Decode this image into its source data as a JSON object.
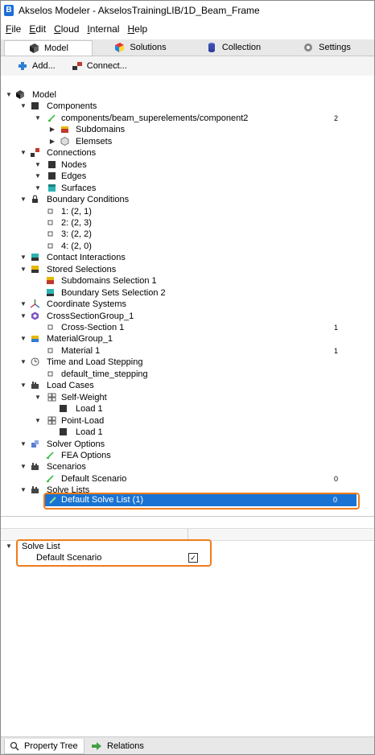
{
  "window": {
    "title": "Akselos Modeler - AkselosTrainingLIB/1D_Beam_Frame"
  },
  "menu": [
    {
      "label": "File",
      "accel": "F",
      "rest": "ile"
    },
    {
      "label": "Edit",
      "accel": "E",
      "rest": "dit"
    },
    {
      "label": "Cloud",
      "accel": "C",
      "rest": "loud"
    },
    {
      "label": "Internal",
      "accel": "I",
      "rest": "nternal"
    },
    {
      "label": "Help",
      "accel": "H",
      "rest": "elp"
    }
  ],
  "tabs": {
    "model": "Model",
    "solutions": "Solutions",
    "collection": "Collection",
    "settings": "Settings"
  },
  "toolbar": {
    "add": "Add...",
    "connect": "Connect..."
  },
  "tree": [
    {
      "label": "Model",
      "depth": 0,
      "expander": "open",
      "icon": "model-icon",
      "count": ""
    },
    {
      "label": "Components",
      "depth": 1,
      "expander": "open",
      "icon": "components-icon",
      "count": ""
    },
    {
      "label": "components/beam_superelements/component2",
      "depth": 2,
      "expander": "open",
      "icon": "component-file-icon",
      "count": "2"
    },
    {
      "label": "Subdomains",
      "depth": 3,
      "expander": "closed",
      "icon": "subdomains-icon",
      "count": ""
    },
    {
      "label": "Elemsets",
      "depth": 3,
      "expander": "closed",
      "icon": "elemsets-icon",
      "count": ""
    },
    {
      "label": "Connections",
      "depth": 1,
      "expander": "open",
      "icon": "connections-icon",
      "count": ""
    },
    {
      "label": "Nodes",
      "depth": 2,
      "expander": "open",
      "icon": "nodes-icon",
      "count": ""
    },
    {
      "label": "Edges",
      "depth": 2,
      "expander": "open",
      "icon": "edges-icon",
      "count": ""
    },
    {
      "label": "Surfaces",
      "depth": 2,
      "expander": "open",
      "icon": "surfaces-icon",
      "count": ""
    },
    {
      "label": "Boundary Conditions",
      "depth": 1,
      "expander": "open",
      "icon": "lock-icon",
      "count": ""
    },
    {
      "label": "1: (2, 1)",
      "depth": 2,
      "expander": "none",
      "icon": "bullet-icon",
      "count": ""
    },
    {
      "label": "2: (2, 3)",
      "depth": 2,
      "expander": "none",
      "icon": "bullet-icon",
      "count": ""
    },
    {
      "label": "3: (2, 2)",
      "depth": 2,
      "expander": "none",
      "icon": "bullet-icon",
      "count": ""
    },
    {
      "label": "4: (2, 0)",
      "depth": 2,
      "expander": "none",
      "icon": "bullet-icon",
      "count": ""
    },
    {
      "label": "Contact Interactions",
      "depth": 1,
      "expander": "open",
      "icon": "contact-icon",
      "count": ""
    },
    {
      "label": "Stored Selections",
      "depth": 1,
      "expander": "open",
      "icon": "stored-selections-icon",
      "count": ""
    },
    {
      "label": "Subdomains Selection 1",
      "depth": 2,
      "expander": "none",
      "icon": "subdomains-selection-icon",
      "count": ""
    },
    {
      "label": "Boundary Sets Selection 2",
      "depth": 2,
      "expander": "none",
      "icon": "boundary-selection-icon",
      "count": ""
    },
    {
      "label": "Coordinate Systems",
      "depth": 1,
      "expander": "open",
      "icon": "axes-icon",
      "count": ""
    },
    {
      "label": "CrossSectionGroup_1",
      "depth": 1,
      "expander": "open",
      "icon": "cross-section-group-icon",
      "count": ""
    },
    {
      "label": "Cross-Section 1",
      "depth": 2,
      "expander": "none",
      "icon": "bullet-icon",
      "count": "1"
    },
    {
      "label": "MaterialGroup_1",
      "depth": 1,
      "expander": "open",
      "icon": "material-group-icon",
      "count": ""
    },
    {
      "label": "Material 1",
      "depth": 2,
      "expander": "none",
      "icon": "bullet-icon",
      "count": "1"
    },
    {
      "label": "Time and Load Stepping",
      "depth": 1,
      "expander": "open",
      "icon": "clock-icon",
      "count": ""
    },
    {
      "label": "default_time_stepping",
      "depth": 2,
      "expander": "none",
      "icon": "bullet-icon",
      "count": ""
    },
    {
      "label": "Load Cases",
      "depth": 1,
      "expander": "open",
      "icon": "load-cases-icon",
      "count": ""
    },
    {
      "label": "Self-Weight",
      "depth": 2,
      "expander": "open",
      "icon": "grid-icon",
      "count": ""
    },
    {
      "label": "Load 1",
      "depth": 3,
      "expander": "none",
      "icon": "load-icon",
      "count": ""
    },
    {
      "label": "Point-Load",
      "depth": 2,
      "expander": "open",
      "icon": "grid-icon",
      "count": ""
    },
    {
      "label": "Load 1",
      "depth": 3,
      "expander": "none",
      "icon": "load-icon",
      "count": ""
    },
    {
      "label": "Solver Options",
      "depth": 1,
      "expander": "open",
      "icon": "solver-options-icon",
      "count": ""
    },
    {
      "label": "FEA Options",
      "depth": 2,
      "expander": "none",
      "icon": "pencil-icon",
      "count": ""
    },
    {
      "label": "Scenarios",
      "depth": 1,
      "expander": "open",
      "icon": "scenarios-icon",
      "count": ""
    },
    {
      "label": "Default Scenario",
      "depth": 2,
      "expander": "none",
      "icon": "pencil-icon",
      "count": "0"
    },
    {
      "label": "Solve Lists",
      "depth": 1,
      "expander": "open",
      "icon": "solve-lists-icon",
      "count": ""
    }
  ],
  "selected_item": {
    "label": "Default Solve List (1)",
    "count": "0"
  },
  "properties": {
    "section_label": "Solve List",
    "field_label": "Default Scenario",
    "checked": true,
    "check_glyph": "✓"
  },
  "bottom_tabs": {
    "property_tree": "Property Tree",
    "relations": "Relations"
  },
  "colors": {
    "selection": "#1a73d2",
    "highlight_outline": "#f07c19"
  }
}
